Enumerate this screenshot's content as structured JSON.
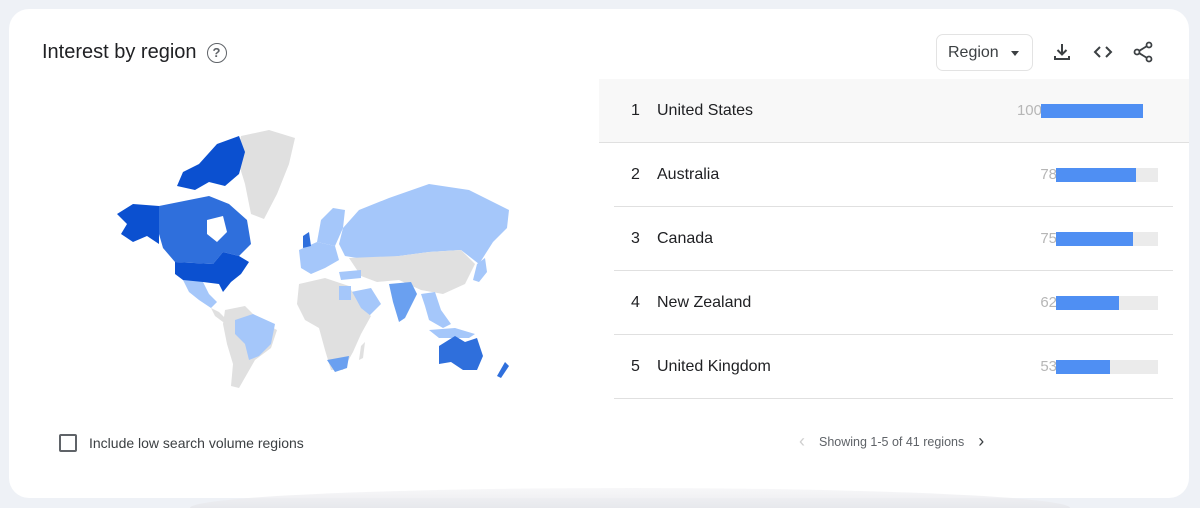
{
  "widget": {
    "title": "Interest by region",
    "help_icon": "help-circle-icon",
    "resolution_select": {
      "selected": "Region"
    },
    "toolbar_icons": [
      "download-icon",
      "embed-code-icon",
      "share-icon"
    ]
  },
  "regions": [
    {
      "rank": "1",
      "name": "United States",
      "value": 100
    },
    {
      "rank": "2",
      "name": "Australia",
      "value": 78
    },
    {
      "rank": "3",
      "name": "Canada",
      "value": 75
    },
    {
      "rank": "4",
      "name": "New Zealand",
      "value": 62
    },
    {
      "rank": "5",
      "name": "United Kingdom",
      "value": 53
    }
  ],
  "pagination": {
    "label": "Showing 1-5 of 41 regions"
  },
  "low_volume_checkbox": {
    "label": "Include low search volume regions",
    "checked": false
  },
  "colors": {
    "bar_fill": "#4f8ff3",
    "bar_track": "#ebebeb",
    "map_max": "#0b50d0",
    "map_high": "#2f6fdc",
    "map_mid": "#6aa0f0",
    "map_low": "#a5c7fa",
    "map_none": "#e0e0e0"
  },
  "map_shading": {
    "United States": "max",
    "Alaska (US)": "max",
    "Canada": "high",
    "Australia": "high",
    "New Zealand": "high",
    "United Kingdom": "high",
    "India": "mid",
    "South Africa": "mid",
    "Russia": "low",
    "Brazil": "low",
    "Mexico": "low",
    "Western Europe": "low",
    "Scandinavia": "low",
    "Turkey": "low",
    "Egypt": "low",
    "Saudi Arabia": "low",
    "Southeast Asia": "low",
    "Japan": "low",
    "Greenland": "none",
    "Africa": "none",
    "China/Central Asia": "none",
    "South America (rest)": "none"
  }
}
